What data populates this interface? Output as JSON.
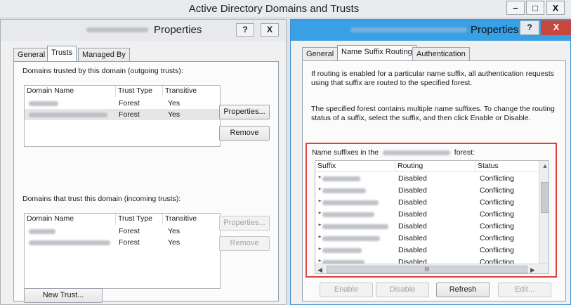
{
  "main_window": {
    "title": "Active Directory Domains and Trusts",
    "minimize_glyph": "–",
    "maximize_glyph": "□",
    "close_glyph": "X"
  },
  "left_dialog": {
    "title": "Properties",
    "help_glyph": "?",
    "close_glyph": "X",
    "tabs": [
      {
        "label": "General",
        "active": false
      },
      {
        "label": "Trusts",
        "active": true
      },
      {
        "label": "Managed By",
        "active": false
      }
    ],
    "outgoing": {
      "heading": "Domains trusted by this domain (outgoing trusts):",
      "columns": [
        "Domain Name",
        "Trust Type",
        "Transitive"
      ],
      "rows": [
        {
          "trust_type": "Forest",
          "transitive": "Yes",
          "selected": false
        },
        {
          "trust_type": "Forest",
          "transitive": "Yes",
          "selected": true
        }
      ],
      "properties_button": "Properties...",
      "remove_button": "Remove"
    },
    "incoming": {
      "heading": "Domains that trust this domain (incoming trusts):",
      "columns": [
        "Domain Name",
        "Trust Type",
        "Transitive"
      ],
      "rows": [
        {
          "trust_type": "Forest",
          "transitive": "Yes"
        },
        {
          "trust_type": "Forest",
          "transitive": "Yes"
        }
      ],
      "properties_button": "Properties...",
      "remove_button": "Remove"
    },
    "new_trust_button": "New Trust..."
  },
  "right_dialog": {
    "title": "Properties",
    "help_glyph": "?",
    "close_glyph": "X",
    "tabs": [
      {
        "label": "General",
        "active": false
      },
      {
        "label": "Name Suffix Routing",
        "active": true
      },
      {
        "label": "Authentication",
        "active": false
      }
    ],
    "info_1": "If routing is enabled for a particular name suffix, all authentication requests using that suffix are routed to the specified forest.",
    "info_2": "The specified forest contains multiple name suffixes. To change the routing status of a suffix, select the suffix, and then click Enable or Disable.",
    "list_label_prefix": "Name suffixes in the",
    "list_label_suffix": "forest:",
    "columns": [
      "Suffix",
      "Routing",
      "Status"
    ],
    "rows": [
      {
        "prefix": "*",
        "routing": "Disabled",
        "status": "Conflicting"
      },
      {
        "prefix": "*",
        "routing": "Disabled",
        "status": "Conflicting"
      },
      {
        "prefix": "*",
        "routing": "Disabled",
        "status": "Conflicting"
      },
      {
        "prefix": "*",
        "routing": "Disabled",
        "status": "Conflicting"
      },
      {
        "prefix": "*",
        "routing": "Disabled",
        "status": "Conflicting"
      },
      {
        "prefix": "*",
        "routing": "Disabled",
        "status": "Conflicting"
      },
      {
        "prefix": "*",
        "routing": "Disabled",
        "status": "Conflicting"
      },
      {
        "prefix": "*",
        "routing": "Disabled",
        "status": "Conflicting"
      }
    ],
    "hscroll_thumb_glyph": "III",
    "buttons": {
      "enable": "Enable",
      "disable": "Disable",
      "refresh": "Refresh",
      "edit": "Edit..."
    }
  },
  "colors": {
    "highlight_border": "#e0403a",
    "active_title_bar": "#3aa0e6",
    "close_button": "#c7473e"
  }
}
